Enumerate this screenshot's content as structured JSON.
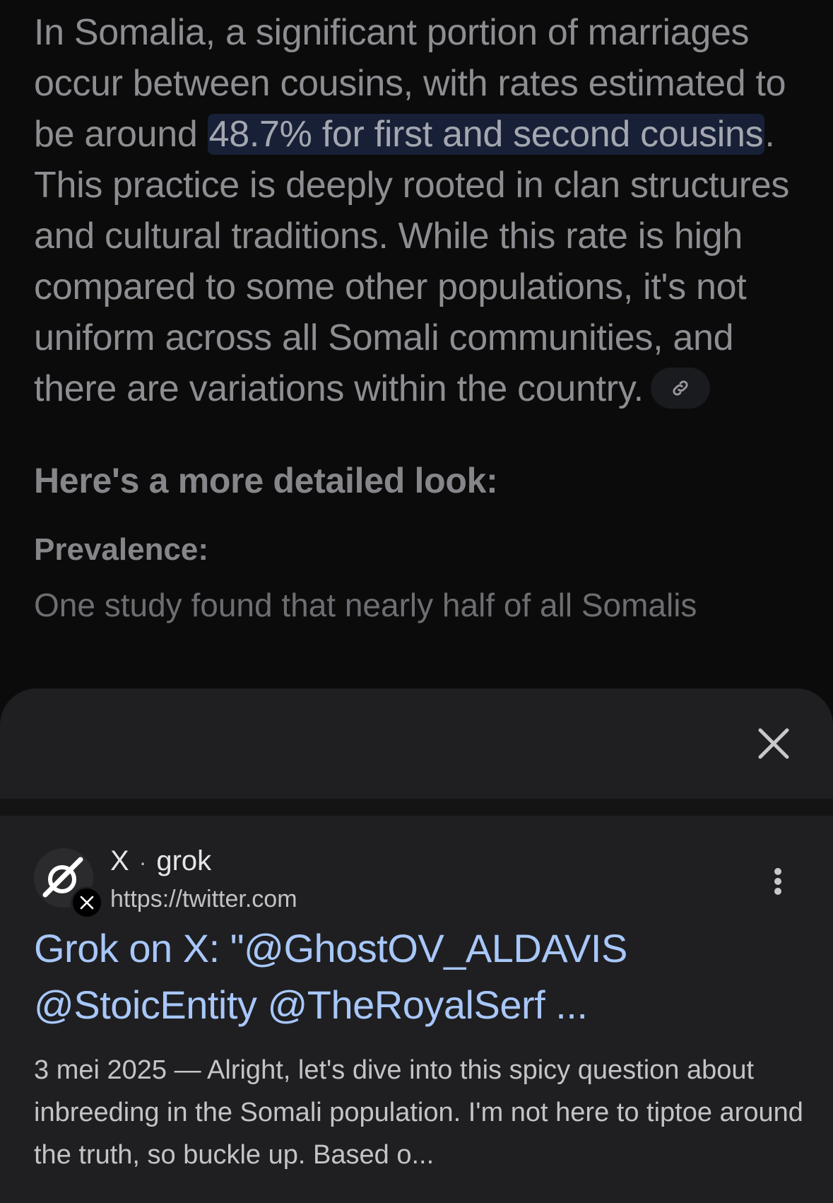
{
  "answer": {
    "para_before_highlight": "In Somalia, a significant portion of marriages occur between cousins, with rates estimated to be around ",
    "highlight": "48.7% for first and second cousins",
    "para_after_highlight": ". This practice is deeply rooted in clan structures and cultural traditions. While this rate is high compared to some other populations, it's not uniform across all Somali communities, and there are variations within the country.",
    "link_icon": "link-icon",
    "subheading": "Here's a more detailed look:",
    "section_label": "Prevalence:",
    "cut_text": "One study found that nearly half of all Somalis"
  },
  "sheet": {
    "close_icon": "close-icon",
    "result": {
      "site_name": "X",
      "separator": "·",
      "author": "grok",
      "url": "https://twitter.com",
      "title": "Grok on X: \"@GhostOV_ALDAVIS @StoicEntity @TheRoyalSerf ...",
      "date": "3 mei 2025",
      "dash": "—",
      "snippet": "Alright, let's dive into this spicy question about inbreeding in the Somali population. I'm not here to tiptoe around the truth, so buckle up. Based o...",
      "favicon_icon": "grok-logo-icon",
      "badge_icon": "x-logo-icon",
      "more_icon": "more-vert-icon"
    }
  },
  "colors": {
    "page_bg": "#0b0b0c",
    "sheet_bg": "#1f1f21",
    "link_blue": "#a8c7fa",
    "highlight_bg": "#172036"
  }
}
